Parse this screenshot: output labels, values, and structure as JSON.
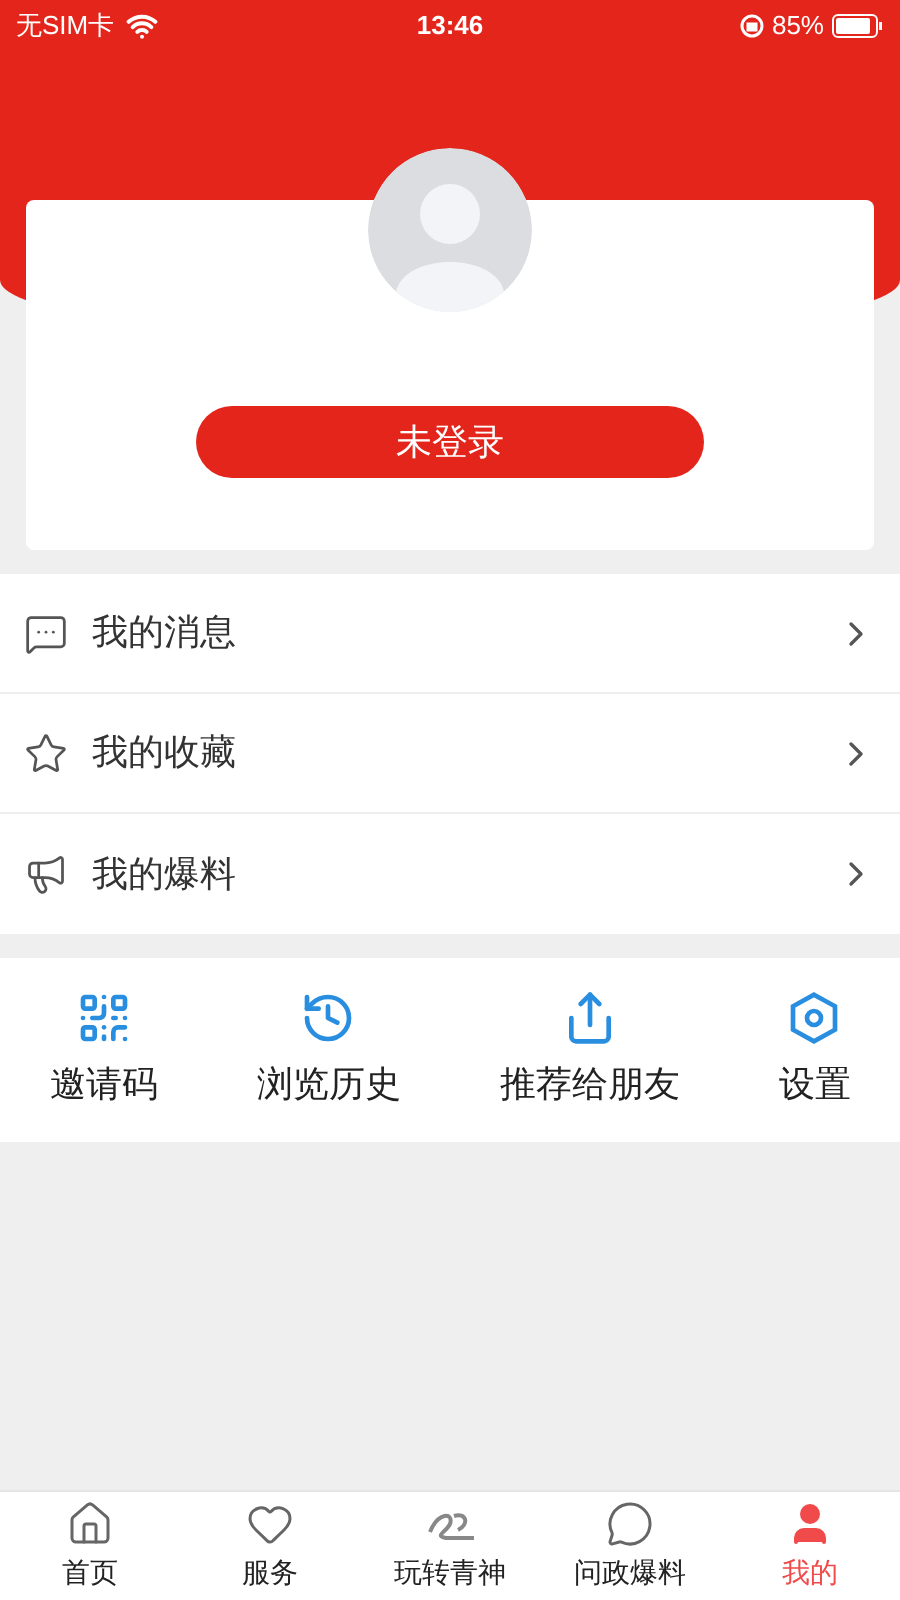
{
  "status_bar": {
    "carrier": "无SIM卡",
    "time": "13:46",
    "battery": "85%"
  },
  "profile": {
    "login_button": "未登录"
  },
  "menu": [
    {
      "kind": "message",
      "label": "我的消息"
    },
    {
      "kind": "star",
      "label": "我的收藏"
    },
    {
      "kind": "megaphone",
      "label": "我的爆料"
    }
  ],
  "shortcuts": [
    {
      "kind": "qr",
      "label": "邀请码"
    },
    {
      "kind": "history",
      "label": "浏览历史"
    },
    {
      "kind": "share",
      "label": "推荐给朋友"
    },
    {
      "kind": "settings",
      "label": "设置"
    }
  ],
  "tabs": [
    {
      "kind": "home",
      "label": "首页",
      "selected": false
    },
    {
      "kind": "service",
      "label": "服务",
      "selected": false
    },
    {
      "kind": "fun",
      "label": "玩转青神",
      "selected": false
    },
    {
      "kind": "report",
      "label": "问政爆料",
      "selected": false
    },
    {
      "kind": "me",
      "label": "我的",
      "selected": true
    }
  ]
}
